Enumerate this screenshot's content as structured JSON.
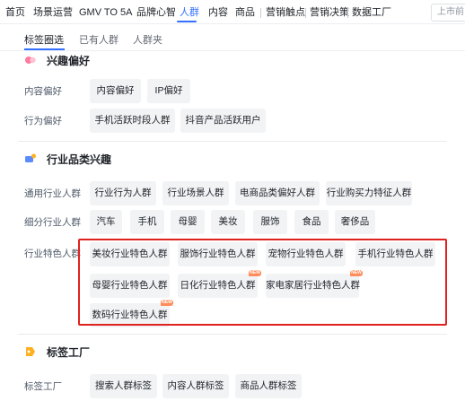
{
  "nav": {
    "items": [
      "首页",
      "场景运营",
      "GMV TO 5A",
      "品牌心智",
      "人群",
      "内容",
      "商品",
      "营销触点",
      "营销决策",
      "数据工厂"
    ],
    "active_index": 4,
    "search_placeholder": "上市前"
  },
  "subtabs": {
    "items": [
      "标签圈选",
      "已有人群",
      "人群夹"
    ],
    "active_index": 0
  },
  "sections": {
    "interest": {
      "title": "兴趣偏好",
      "rows": [
        {
          "label": "内容偏好",
          "tags": [
            "内容偏好",
            "IP偏好"
          ]
        },
        {
          "label": "行为偏好",
          "tags": [
            "手机活跃时段人群",
            "抖音产品活跃用户"
          ]
        }
      ]
    },
    "industry": {
      "title": "行业品类兴趣",
      "rows": [
        {
          "label": "通用行业人群",
          "tags": [
            "行业行为人群",
            "行业场景人群",
            "电商品类偏好人群",
            "行业购买力特征人群"
          ]
        },
        {
          "label": "细分行业人群",
          "tags": [
            "汽车",
            "手机",
            "母婴",
            "美妆",
            "服饰",
            "食品",
            "奢侈品"
          ]
        },
        {
          "label": "行业特色人群",
          "tags": [
            "美妆行业特色人群",
            "服饰行业特色人群",
            "宠物行业特色人群",
            "手机行业特色人群",
            "母婴行业特色人群",
            "日化行业特色人群",
            "家电家居行业特色人群",
            "数码行业特色人群"
          ]
        }
      ],
      "new_badge": "NEW"
    },
    "factory": {
      "title": "标签工厂",
      "rows": [
        {
          "label": "标签工厂",
          "tags": [
            "搜索人群标签",
            "内容人群标签",
            "商品人群标签"
          ]
        }
      ]
    }
  },
  "colors": {
    "accent": "#3370ff",
    "highlight": "#e0221f",
    "new_badge": "#ff8c5a"
  }
}
